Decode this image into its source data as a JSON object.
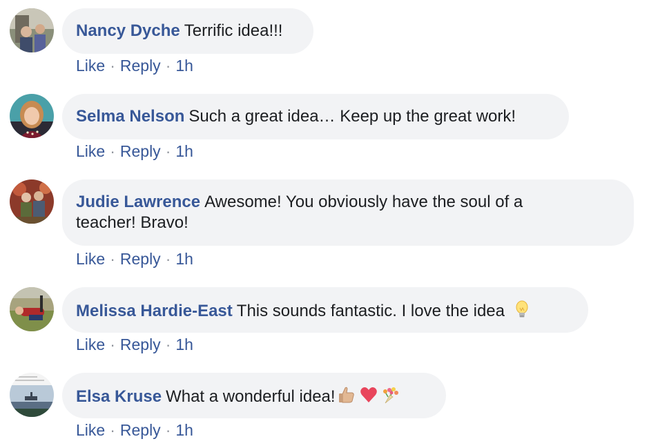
{
  "comments": [
    {
      "name": "Nancy Dyche",
      "text": "Terrific idea!!!",
      "like": "Like",
      "reply": "Reply",
      "time": "1h",
      "avatar_icon": "person-photo-avatar"
    },
    {
      "name": "Selma Nelson",
      "text": "Such a great idea… Keep up the great work!",
      "like": "Like",
      "reply": "Reply",
      "time": "1h",
      "avatar_icon": "person-photo-avatar"
    },
    {
      "name": "Judie Lawrence",
      "text": "Awesome! You obviously have the soul of a teacher! Bravo!",
      "like": "Like",
      "reply": "Reply",
      "time": "1h",
      "avatar_icon": "person-photo-avatar"
    },
    {
      "name": "Melissa Hardie-East",
      "text": "This sounds fantastic. I love the idea",
      "emojis": [
        "light-bulb-emoji"
      ],
      "like": "Like",
      "reply": "Reply",
      "time": "1h",
      "avatar_icon": "person-photo-avatar"
    },
    {
      "name": "Elsa Kruse",
      "text": "What a wonderful idea!",
      "emojis": [
        "thumbs-up-emoji",
        "red-heart-emoji",
        "bouquet-emoji"
      ],
      "like": "Like",
      "reply": "Reply",
      "time": "1h",
      "avatar_icon": "landscape-photo-avatar"
    }
  ],
  "colors": {
    "name_link": "#385898",
    "bubble_bg": "#f2f3f5",
    "text": "#1c1e21",
    "separator": "#90949c"
  }
}
